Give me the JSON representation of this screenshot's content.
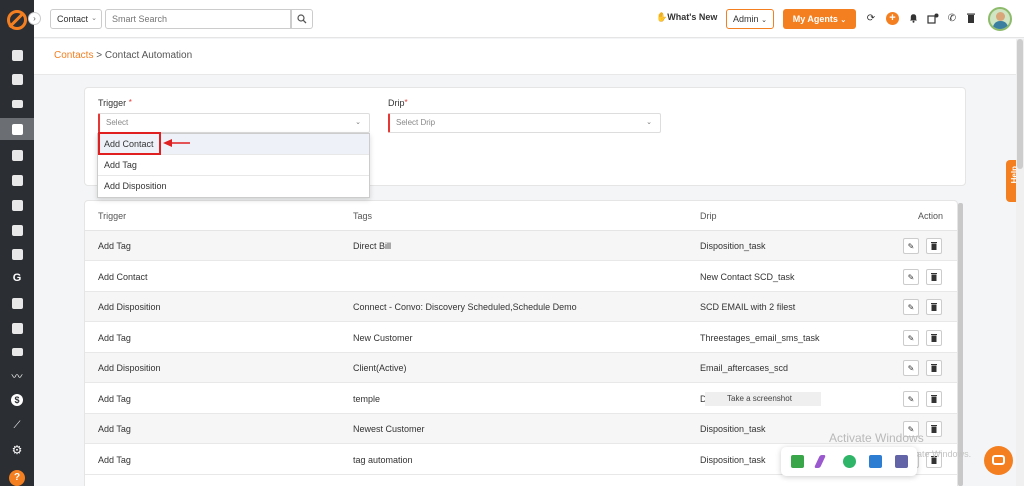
{
  "topbar": {
    "module_select": "Contact",
    "search_placeholder": "Smart Search",
    "whats_new": "What's New",
    "admin_label": "Admin",
    "agents_label": "My Agents"
  },
  "breadcrumb": {
    "parent": "Contacts",
    "separator": ">",
    "current": "Contact Automation"
  },
  "form": {
    "trigger_label": "Trigger",
    "trigger_placeholder": "Select",
    "drip_label": "Drip",
    "drip_placeholder": "Select Drip",
    "required_mark": "*"
  },
  "dropdown": {
    "options": [
      "Add Contact",
      "Add Tag",
      "Add Disposition"
    ]
  },
  "table": {
    "headers": {
      "trigger": "Trigger",
      "tags": "Tags",
      "drip": "Drip",
      "action": "Action"
    },
    "rows": [
      {
        "trigger": "Add Tag",
        "tags": "Direct Bill",
        "drip": "Disposition_task"
      },
      {
        "trigger": "Add Contact",
        "tags": "",
        "drip": "New Contact SCD_task"
      },
      {
        "trigger": "Add Disposition",
        "tags": "Connect - Convo: Discovery Scheduled,Schedule Demo",
        "drip": "SCD EMAIL with 2 filest"
      },
      {
        "trigger": "Add Tag",
        "tags": "New Customer",
        "drip": "Threestages_email_sms_task"
      },
      {
        "trigger": "Add Disposition",
        "tags": "Client(Active)",
        "drip": "Email_aftercases_scd"
      },
      {
        "trigger": "Add Tag",
        "tags": "temple",
        "drip": "D"
      },
      {
        "trigger": "Add Tag",
        "tags": "Newest Customer",
        "drip": "Disposition_task"
      },
      {
        "trigger": "Add Tag",
        "tags": "tag automation",
        "drip": "Disposition_task"
      }
    ]
  },
  "overlays": {
    "help_tab": "Help",
    "tooltip": "Take a screenshot",
    "activate_title": "Activate Windows",
    "activate_sub": "Go to Settings to activate Windows."
  },
  "colors": {
    "accent": "#f47f20",
    "sidebar": "#2b2e33",
    "required": "#e53935",
    "annotation": "#e02020"
  }
}
